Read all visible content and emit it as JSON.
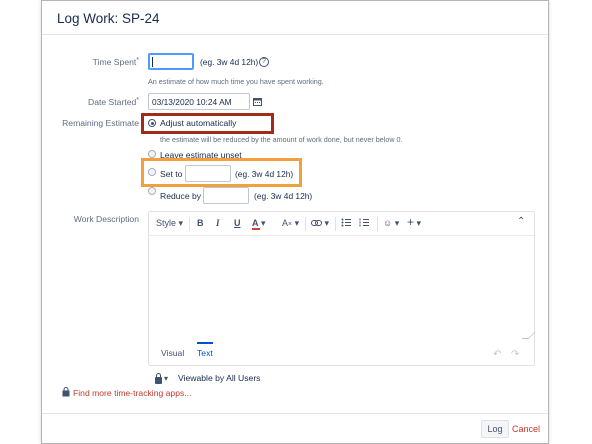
{
  "dialog": {
    "title": "Log Work: SP-24"
  },
  "form": {
    "time_spent": {
      "label": "Time Spent",
      "required_mark": "*",
      "value": "",
      "hint": "(eg. 3w 4d 12h)",
      "help_icon": "?",
      "description": "An estimate of how much time you have spent working."
    },
    "date_started": {
      "label": "Date Started",
      "required_mark": "*",
      "value": "03/13/2020 10:24 AM",
      "icon": "calendar-icon"
    },
    "remaining_estimate": {
      "label": "Remaining Estimate",
      "options": [
        {
          "label": "Adjust automatically",
          "checked": true,
          "description": "the estimate will be reduced by the amount of work done, but never below 0."
        },
        {
          "label": "Leave estimate unset",
          "checked": false
        },
        {
          "label": "Set to",
          "checked": false,
          "value": "",
          "hint": "(eg. 3w 4d 12h)"
        },
        {
          "label": "Reduce by",
          "checked": false,
          "value": "",
          "hint": "(eg. 3w 4d 12h)"
        }
      ]
    },
    "work_description": {
      "label": "Work Description",
      "toolbar": {
        "style": "Style",
        "bold": "B",
        "italic": "I",
        "underline": "U",
        "text_color": "A",
        "more_formatting": "A",
        "link": "link",
        "bullets": "bullets",
        "numbers": "numbers",
        "emoji": "☺",
        "insert": "+",
        "collapse": "⌃"
      },
      "tabs": [
        {
          "label": "Visual",
          "active": false
        },
        {
          "label": "Text",
          "active": true
        }
      ],
      "value": ""
    },
    "visibility": {
      "label": "Viewable by All Users"
    }
  },
  "links": {
    "apps": "Find more time-tracking apps..."
  },
  "footer": {
    "log_button": "Log",
    "cancel_link": "Cancel"
  },
  "annotations": {
    "highlight_colors": {
      "red": "#a12a1b",
      "orange": "#f2a03d"
    }
  }
}
